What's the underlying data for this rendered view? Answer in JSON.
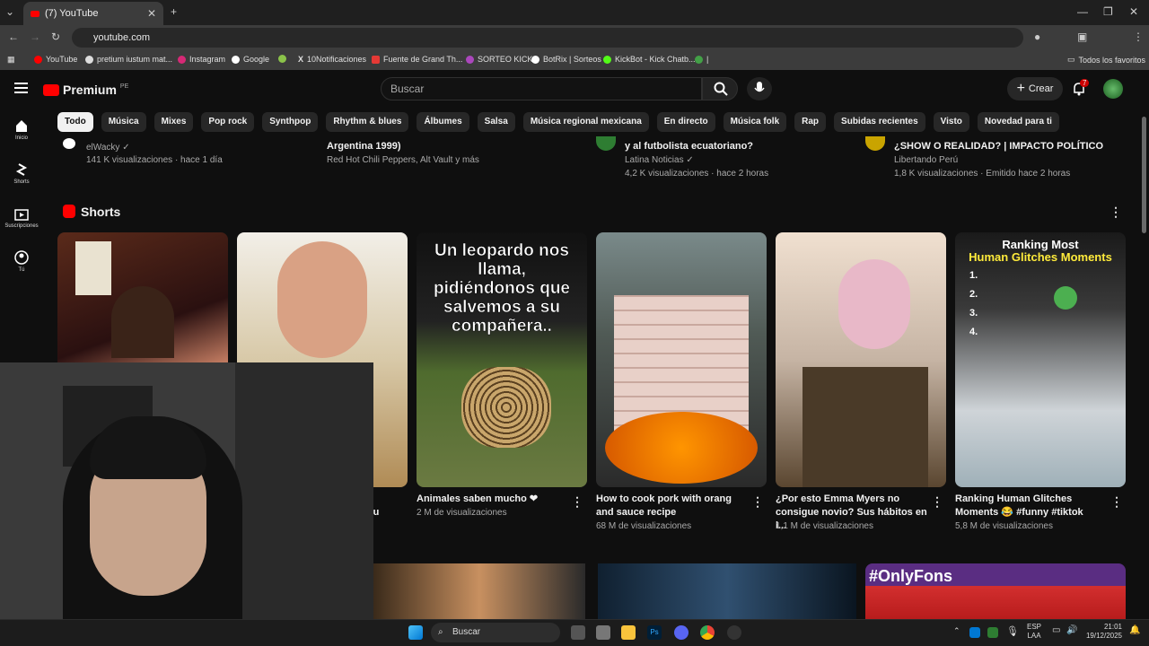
{
  "browser": {
    "tab_title": "(7) YouTube",
    "url": "youtube.com",
    "bookmarks": [
      "YouTube",
      "pretium iustum mat...",
      "Instagram",
      "Google",
      "10Notificaciones",
      "Fuente de Grand Th...",
      "SORTEO KICK",
      "BotRix | Sorteos",
      "KickBot - Kick Chatb...",
      "|"
    ],
    "all_bookmarks_label": "Todos los favoritos"
  },
  "youtube": {
    "logo_text": "Premium",
    "logo_region": "PE",
    "search_placeholder": "Buscar",
    "create_label": "Crear",
    "notif_count": "7",
    "chips": [
      "Todo",
      "Música",
      "Mixes",
      "Pop rock",
      "Synthpop",
      "Rhythm & blues",
      "Álbumes",
      "Salsa",
      "Música regional mexicana",
      "En directo",
      "Música folk",
      "Rap",
      "Subidas recientes",
      "Visto",
      "Novedad para ti"
    ],
    "sidebar": [
      "Inicio",
      "Shorts",
      "Suscripciones",
      "Tú"
    ],
    "top_row": [
      {
        "title": "",
        "channel": "elWacky",
        "stats": "141 K visualizaciones · hace 1 día"
      },
      {
        "title": "Argentina 1999)",
        "channel": "Red Hot Chili Peppers, Alt Vault y más",
        "stats": ""
      },
      {
        "title": "y al futbolista ecuatoriano?",
        "channel": "Latina Noticias",
        "stats": "4,2 K visualizaciones · hace 2 horas"
      },
      {
        "title": "¿SHOW O REALIDAD? | IMPACTO POLÍTICO",
        "channel": "Libertando Perú",
        "stats": "1,8 K visualizaciones · Emitido hace 2 horas"
      }
    ],
    "shorts_heading": "Shorts",
    "shorts": [
      {
        "title": "",
        "views": ""
      },
      {
        "title": "...eru",
        "views": ""
      },
      {
        "title": "Animales saben mucho ❤",
        "views": "2 M de visualizaciones",
        "overlay": "Un leopardo nos llama, pidiéndonos que salvemos a su compañera.."
      },
      {
        "title": "How to cook pork with orang and sauce recipe",
        "views": "68 M de visualizaciones"
      },
      {
        "title": "¿Por esto Emma Myers no consigue novio? Sus hábitos en l...",
        "views": "1,1 M de visualizaciones"
      },
      {
        "title": "Ranking Human Glitches Moments 😂 #funny #tiktok",
        "views": "5,8 M de visualizaciones",
        "overlay1": "Ranking Most",
        "overlay2": "Human Glitches Moments"
      }
    ],
    "bottom_badge": "#OnlyFons"
  },
  "taskbar": {
    "search": "Buscar",
    "lang": "ESP",
    "lang2": "LAA",
    "time": "21:01",
    "date": "19/12/2025"
  }
}
